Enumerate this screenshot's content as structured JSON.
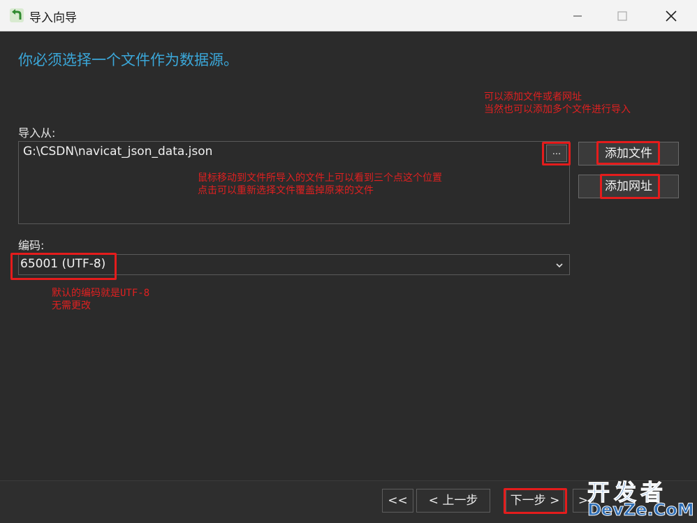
{
  "window": {
    "title": "导入向导",
    "icon": "import-arrow-icon"
  },
  "heading": "你必须选择一个文件作为数据源。",
  "import_from": {
    "label": "导入从:",
    "files": [
      "G:\\CSDN\\navicat_json_data.json"
    ],
    "browse_label": "...",
    "add_file_label": "添加文件",
    "add_url_label": "添加网址"
  },
  "encoding": {
    "label": "编码:",
    "selected": "65001 (UTF-8)"
  },
  "annotations": {
    "add_note_line1": "可以添加文件或者网址",
    "add_note_line2": "当然也可以添加多个文件进行导入",
    "dots_note_line1": "鼠标移动到文件所导入的文件上可以看到三个点这个位置",
    "dots_note_line2": "点击可以重新选择文件覆盖掉原来的文件",
    "encoding_note_line1": "默认的编码就是UTF-8",
    "encoding_note_line2": "无需更改"
  },
  "nav": {
    "first": "<<",
    "prev": "< 上一步",
    "next": "下一步 >",
    "last": ">"
  },
  "watermark": {
    "line1": "开发者",
    "line2": "DevZe.CoM"
  },
  "colors": {
    "accent": "#3ba7d9",
    "annotation": "#e02020",
    "background": "#2b2b2b"
  }
}
